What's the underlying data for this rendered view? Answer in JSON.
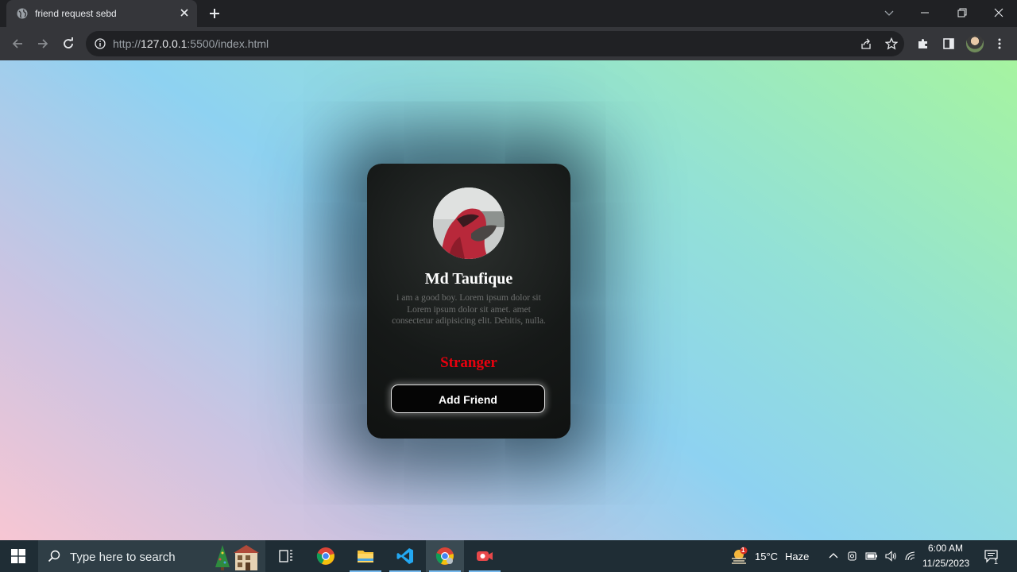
{
  "browser": {
    "tab_title": "friend request sebd",
    "url_prefix": "http://",
    "url_host": "127.0.0.1",
    "url_rest": ":5500/index.html"
  },
  "card": {
    "name": "Md Taufique",
    "bio": "i am a good boy. Lorem ipsum dolor sit Lorem ipsum dolor sit amet. amet consectetur adipisicing elit. Debitis, nulla.",
    "status": "Stranger",
    "button_label": "Add Friend",
    "status_color": "#e8000e"
  },
  "taskbar": {
    "search_placeholder": "Type here to search",
    "weather_temp": "15°C",
    "weather_desc": "Haze",
    "weather_badge": "1",
    "time": "6:00 AM",
    "date": "11/25/2023",
    "notification_count": "1",
    "apps": [
      "task-view-icon",
      "chrome-icon",
      "file-explorer-icon",
      "vscode-icon",
      "chrome-icon",
      "screen-recorder-icon"
    ]
  }
}
